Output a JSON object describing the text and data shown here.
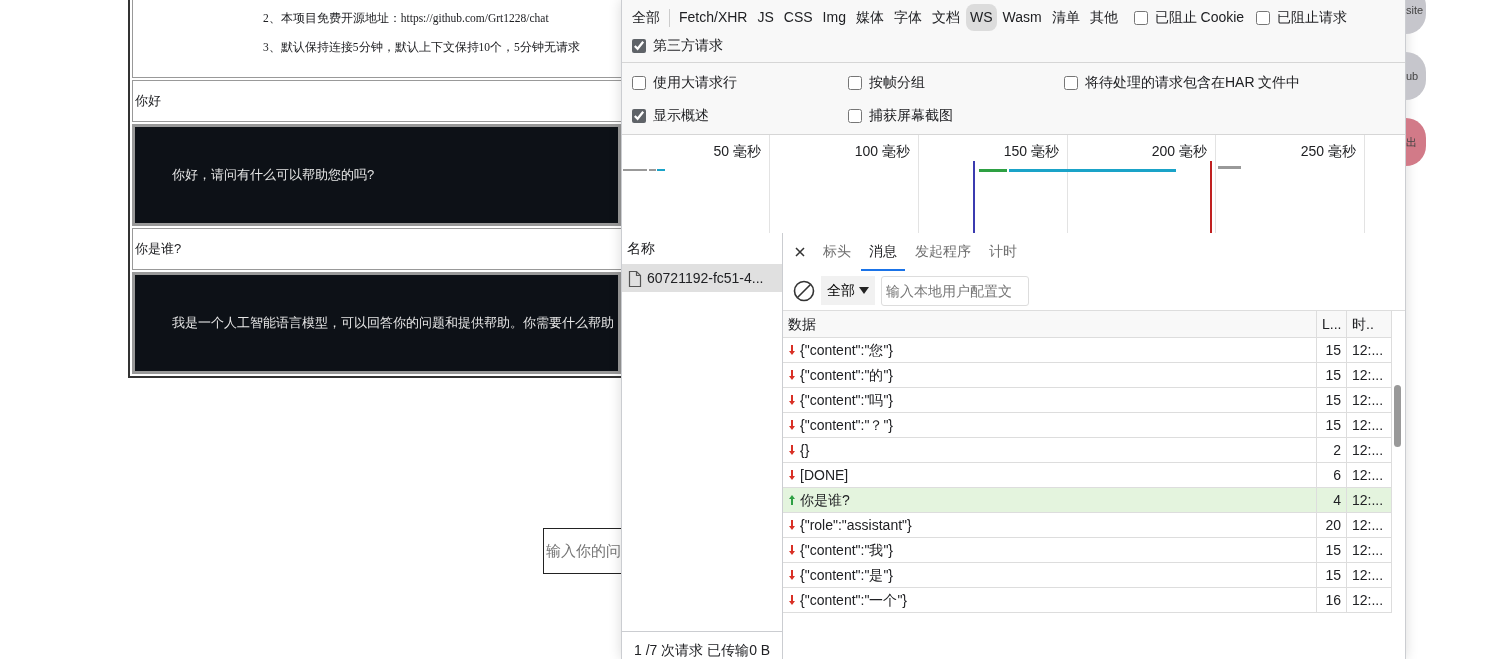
{
  "page": {
    "notice_lines": [
      {
        "text": "2、本项目免费开源地址：",
        "link": "https://github.com/Grt1228/chat"
      },
      {
        "text": "3、默认保持连接5分钟，默认上下文保持10个，5分钟无请求"
      }
    ],
    "messages": [
      {
        "kind": "user",
        "text": "你好"
      },
      {
        "kind": "assistant",
        "text": "你好，请问有什么可以帮助您的吗?"
      },
      {
        "kind": "user",
        "text": "你是谁?"
      },
      {
        "kind": "assistant",
        "text": "我是一个人工智能语言模型，可以回答你的问题和提供帮助。你需要什么帮助"
      }
    ],
    "input": {
      "placeholder": "输入你的问"
    }
  },
  "side_buttons": [
    {
      "label": "site",
      "color": "#c6c6cc"
    },
    {
      "label": "ub",
      "color": "#c6c6cc"
    },
    {
      "label": "出",
      "color": "#d27a88"
    }
  ],
  "devtools": {
    "filters": [
      {
        "label": "全部",
        "selected": false
      },
      {
        "label": "Fetch/XHR",
        "selected": false
      },
      {
        "label": "JS",
        "selected": false
      },
      {
        "label": "CSS",
        "selected": false
      },
      {
        "label": "Img",
        "selected": false
      },
      {
        "label": "媒体",
        "selected": false
      },
      {
        "label": "字体",
        "selected": false
      },
      {
        "label": "文档",
        "selected": false
      },
      {
        "label": "WS",
        "selected": true
      },
      {
        "label": "Wasm",
        "selected": false
      },
      {
        "label": "清单",
        "selected": false
      },
      {
        "label": "其他",
        "selected": false
      }
    ],
    "filter_checks": [
      {
        "label": "已阻止 Cookie",
        "checked": false
      },
      {
        "label": "已阻止请求",
        "checked": false
      },
      {
        "label": "第三方请求",
        "checked": true
      }
    ],
    "settings": [
      {
        "label": "使用大请求行",
        "checked": false
      },
      {
        "label": "按帧分组",
        "checked": false
      },
      {
        "label": "将待处理的请求包含在HAR 文件中",
        "checked": false
      },
      {
        "label": "显示概述",
        "checked": true
      },
      {
        "label": "捕获屏幕截图",
        "checked": false
      }
    ],
    "overview": {
      "ticks": [
        "50  毫秒",
        "100  毫秒",
        "150  毫秒",
        "200  毫秒",
        "250  毫秒"
      ]
    },
    "requests": {
      "header": "名称",
      "items": [
        {
          "name": "60721192-fc51-4...",
          "selected": true
        }
      ],
      "status": "1 /7 次请求  已传输0 B"
    },
    "detail_tabs": [
      {
        "label": "标头",
        "selected": false
      },
      {
        "label": "消息",
        "selected": true
      },
      {
        "label": "发起程序",
        "selected": false
      },
      {
        "label": "计时",
        "selected": false
      }
    ],
    "messages_toolbar": {
      "filter": "全部",
      "placeholder": "输入本地用户配置文"
    },
    "columns": [
      "数据",
      "L...",
      "时.."
    ],
    "frames": [
      {
        "kind": "down",
        "data": "{\"content\":\"您\"}",
        "length": "15",
        "time": "12:..."
      },
      {
        "kind": "down",
        "data": "{\"content\":\"的\"}",
        "length": "15",
        "time": "12:..."
      },
      {
        "kind": "down",
        "data": "{\"content\":\"吗\"}",
        "length": "15",
        "time": "12:..."
      },
      {
        "kind": "down",
        "data": "{\"content\":\"？\"}",
        "length": "15",
        "time": "12:..."
      },
      {
        "kind": "down",
        "data": "{}",
        "length": "2",
        "time": "12:..."
      },
      {
        "kind": "down",
        "data": "[DONE]",
        "length": "6",
        "time": "12:..."
      },
      {
        "kind": "up",
        "data": "你是谁?",
        "length": "4",
        "time": "12:..."
      },
      {
        "kind": "down",
        "data": "{\"role\":\"assistant\"}",
        "length": "20",
        "time": "12:..."
      },
      {
        "kind": "down",
        "data": "{\"content\":\"我\"}",
        "length": "15",
        "time": "12:..."
      },
      {
        "kind": "down",
        "data": "{\"content\":\"是\"}",
        "length": "15",
        "time": "12:..."
      },
      {
        "kind": "down",
        "data": "{\"content\":\"一个\"}",
        "length": "16",
        "time": "12:..."
      }
    ]
  }
}
